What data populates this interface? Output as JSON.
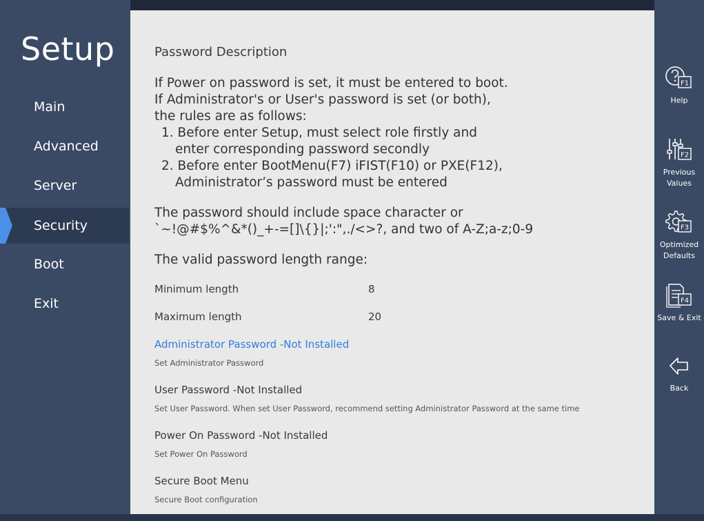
{
  "sidebar": {
    "title": "Setup",
    "items": [
      {
        "label": "Main"
      },
      {
        "label": "Advanced"
      },
      {
        "label": "Server"
      },
      {
        "label": "Security",
        "active": true
      },
      {
        "label": "Boot"
      },
      {
        "label": "Exit"
      }
    ]
  },
  "content": {
    "description_title": "Password Description",
    "para1": [
      "If Power on password is set, it must be entered to boot.",
      "If Administrator's or User's password is set (or both),",
      "the rules are as follows:",
      "1. Before enter Setup, must select role firstly and",
      "enter corresponding password secondly",
      "2. Before enter BootMenu(F7) iFIST(F10) or PXE(F12),",
      "Administrator’s password must be entered"
    ],
    "para2": [
      "The password should include space character or",
      "`~!@#$%^&*()_+-=[]\\{}|;':\",./<>?, and two of A-Z;a-z;0-9"
    ],
    "length_title": "The valid password length range:",
    "min_label": "Minimum length",
    "min_value": "8",
    "max_label": "Maximum length",
    "max_value": "20",
    "menu": [
      {
        "title": "Administrator Password -Not Installed",
        "help": "Set Administrator Password"
      },
      {
        "title": "User Password -Not Installed",
        "help": "Set User Password. When set User Password, recommend setting Administrator Password at the same time"
      },
      {
        "title": "Power On Password -Not Installed",
        "help": "Set Power On Password"
      },
      {
        "title": "Secure Boot Menu",
        "help": "Secure Boot configuration"
      }
    ]
  },
  "functions": [
    {
      "key": "F1",
      "label": "Help",
      "icon": "help-icon"
    },
    {
      "key": "F2",
      "label1": "Previous",
      "label2": "Values",
      "icon": "sliders-icon"
    },
    {
      "key": "F3",
      "label1": "Optimized",
      "label2": "Defaults",
      "icon": "gear-icon"
    },
    {
      "key": "F4",
      "label": "Save & Exit",
      "icon": "save-document-icon"
    },
    {
      "label": "Back",
      "icon": "back-arrow-icon"
    }
  ],
  "colors": {
    "sidebar_bg": "#3a4a64",
    "active_bg": "#2c3a52",
    "accent": "#4a8fe8",
    "content_bg": "#e9e9e9",
    "highlight_text": "#2f7de1"
  }
}
